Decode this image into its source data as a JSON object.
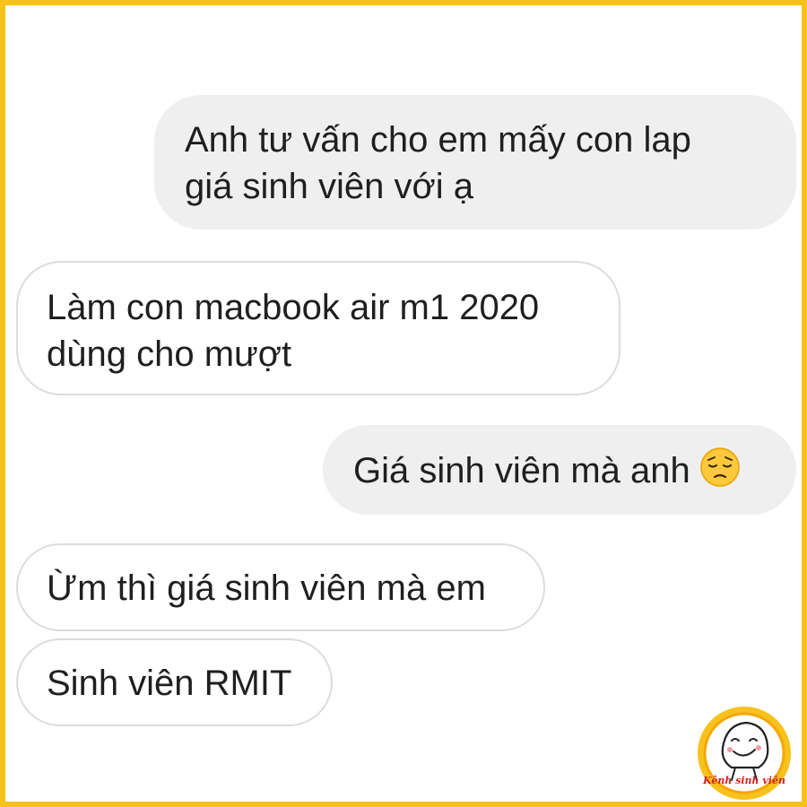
{
  "conversation": {
    "messages": [
      {
        "sender": "me",
        "lines": [
          "Anh tư vấn cho em mấy con lap",
          "giá sinh viên với ạ"
        ]
      },
      {
        "sender": "other",
        "lines": [
          "Làm con macbook air m1 2020",
          "dùng cho mượt"
        ]
      },
      {
        "sender": "me",
        "lines": [
          "Giá sinh viên mà anh"
        ],
        "emoji": "pensive-face-icon"
      },
      {
        "sender": "other",
        "lines": [
          "Ừm thì giá sinh viên mà em"
        ]
      },
      {
        "sender": "other",
        "lines": [
          "Sinh viên RMIT"
        ]
      }
    ]
  },
  "branding": {
    "logo_text": "Kênh sinh viên"
  },
  "colors": {
    "frame": "#f7c21b",
    "outgoing_bubble": "#efefef",
    "incoming_border": "#dcdcdc",
    "emoji": "#ffc83d"
  }
}
